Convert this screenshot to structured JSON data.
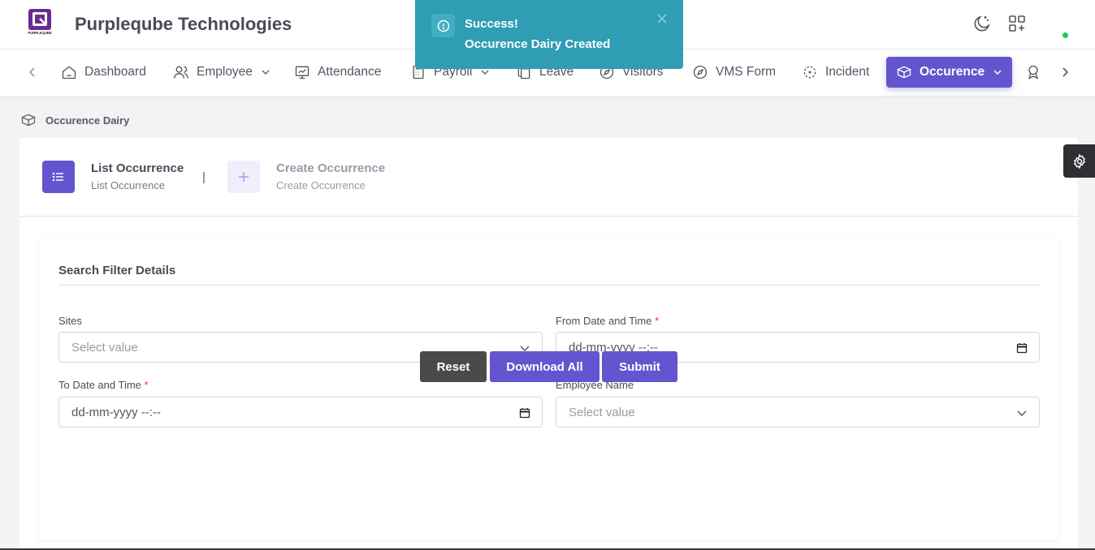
{
  "brand": {
    "name": "Purpleqube Technologies",
    "logo_text": "PURPLEQUBE"
  },
  "colors": {
    "primary": "#6355cf",
    "toast": "#2f9eb5",
    "online": "#22c55e"
  },
  "nav": {
    "items": [
      {
        "label": "Dashboard",
        "icon": "home-icon"
      },
      {
        "label": "Employee",
        "icon": "users-icon",
        "dropdown": true
      },
      {
        "label": "Attendance",
        "icon": "presentation-icon"
      },
      {
        "label": "Payroll",
        "icon": "calculator-icon",
        "dropdown": true
      },
      {
        "label": "Leave",
        "icon": "copy-icon"
      },
      {
        "label": "Visitors",
        "icon": "compass-icon"
      },
      {
        "label": "VMS Form",
        "icon": "compass-icon"
      },
      {
        "label": "Incident",
        "icon": "focus-icon"
      },
      {
        "label": "Occurence",
        "icon": "box-icon",
        "dropdown": true,
        "active": true
      }
    ]
  },
  "toast": {
    "title": "Success!",
    "message": "Occurence Dairy Created"
  },
  "breadcrumb": {
    "label": "Occurence Dairy"
  },
  "stepper": {
    "steps": [
      {
        "title": "List Occurrence",
        "subtitle": "List Occurrence",
        "active": true
      },
      {
        "title": "Create Occurrence",
        "subtitle": "Create Occurrence",
        "active": false
      }
    ],
    "separator": "|"
  },
  "filter": {
    "title": "Search Filter Details",
    "sites": {
      "label": "Sites",
      "placeholder": "Select value"
    },
    "from_date": {
      "label": "From Date and Time",
      "required_mark": "*",
      "value": "dd-mm-yyyy --:--"
    },
    "to_date": {
      "label": "To Date and Time",
      "required_mark": "*",
      "value": "dd-mm-yyyy --:--"
    },
    "employee": {
      "label": "Employee Name",
      "placeholder": "Select value"
    }
  },
  "buttons": {
    "reset": "Reset",
    "download_all": "Download All",
    "submit": "Submit"
  }
}
